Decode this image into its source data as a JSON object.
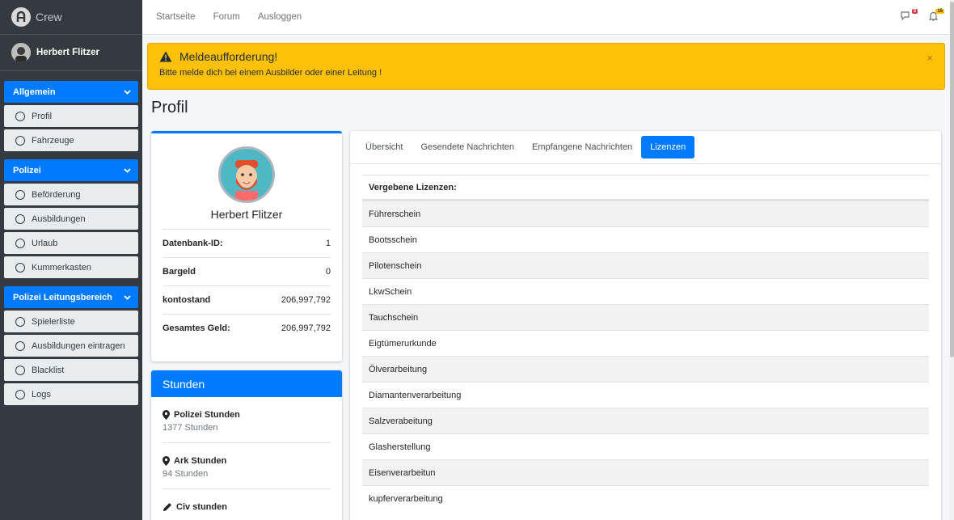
{
  "brand": {
    "name": "Crew"
  },
  "user": {
    "name": "Herbert Flitzer"
  },
  "sidebar": {
    "groups": [
      {
        "title": "Allgemein",
        "items": [
          "Profil",
          "Fahrzeuge"
        ]
      },
      {
        "title": "Polizei",
        "items": [
          "Beförderung",
          "Ausbildungen",
          "Urlaub",
          "Kummerkasten"
        ]
      },
      {
        "title": "Polizei Leitungsbereich",
        "items": [
          "Spielerliste",
          "Ausbildungen eintragen",
          "Blacklist",
          "Logs"
        ]
      }
    ]
  },
  "topnav": {
    "links": [
      "Startseite",
      "Forum",
      "Ausloggen"
    ],
    "messages_badge": "3",
    "notifications_badge": "15"
  },
  "alert": {
    "title": "Meldeaufforderung!",
    "text": "Bitte melde dich bei einem Ausbilder oder einer Leitung !",
    "close": "×"
  },
  "page": {
    "title": "Profil"
  },
  "profile": {
    "name": "Herbert Flitzer",
    "rows": [
      {
        "label": "Datenbank-ID:",
        "value": "1"
      },
      {
        "label": "Bargeld",
        "value": "0"
      },
      {
        "label": "kontostand",
        "value": "206,997,792"
      },
      {
        "label": "Gesamtes Geld:",
        "value": "206,997,792"
      }
    ]
  },
  "stunden": {
    "title": "Stunden",
    "entries": [
      {
        "label": "Polizei Stunden",
        "value": "1377 Stunden",
        "icon": "map-marker-icon"
      },
      {
        "label": "Ark Stunden",
        "value": "94 Stunden",
        "icon": "map-marker-icon"
      },
      {
        "label": "Civ stunden",
        "value": "",
        "icon": "pencil-icon"
      }
    ]
  },
  "tabs": [
    "Übersicht",
    "Gesendete Nachrichten",
    "Empfangene Nachrichten",
    "Lizenzen"
  ],
  "active_tab": "Lizenzen",
  "licenses": {
    "header": "Vergebene Lizenzen:",
    "items": [
      "Führerschein",
      "Bootsschein",
      "Pilotenschein",
      "LkwSchein",
      "Tauchschein",
      "Eigtümerurkunde",
      "Ölverarbeitung",
      "Diamantenverarbeitung",
      "Salzverabeitung",
      "Glasherstellung",
      "Eisenverarbeitun",
      "kupferverarbeitung"
    ]
  },
  "colors": {
    "primary": "#007bff",
    "sidebar": "#343a40",
    "warning": "#ffc107"
  }
}
